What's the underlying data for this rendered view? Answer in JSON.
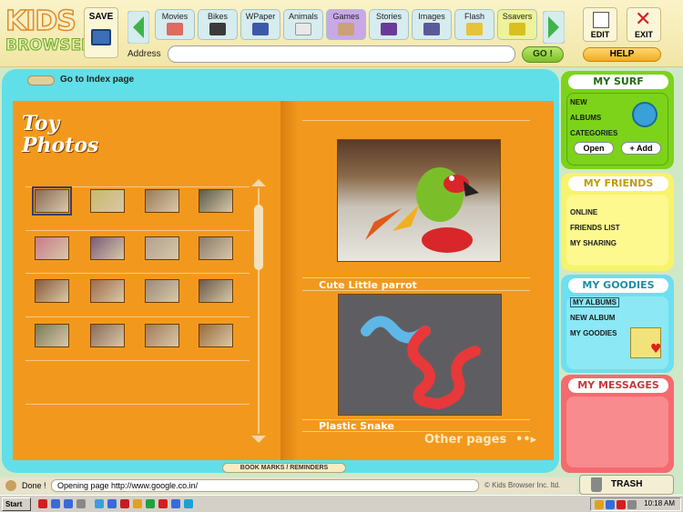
{
  "app": {
    "logo_line1": "KIDS",
    "logo_line2": "BROWSER"
  },
  "toolbar": {
    "save_label": "SAVE",
    "nav_buttons": [
      {
        "label": "Movies",
        "icon": "movies-icon",
        "color": "#e06a5f"
      },
      {
        "label": "Bikes",
        "icon": "bike-icon",
        "color": "#3a3a3a"
      },
      {
        "label": "WPaper",
        "icon": "wallpaper-icon",
        "color": "#3d5aa8"
      },
      {
        "label": "Animals",
        "icon": "animals-icon",
        "color": "#e8e8e8"
      },
      {
        "label": "Games",
        "icon": "games-icon",
        "color": "#c9a27a"
      },
      {
        "label": "Stories",
        "icon": "stories-icon",
        "color": "#6a3a9a"
      },
      {
        "label": "Images",
        "icon": "images-icon",
        "color": "#5a5a9a"
      },
      {
        "label": "Flash",
        "icon": "flash-icon",
        "color": "#e8c23a"
      },
      {
        "label": "Ssavers",
        "icon": "screensaver-icon",
        "color": "#d8c020"
      }
    ],
    "address_label": "Address",
    "address_value": "",
    "go_label": "GO !",
    "edit_label": "EDIT",
    "exit_label": "EXIT",
    "help_label": "HELP"
  },
  "main": {
    "index_link": "Go to Index page",
    "album_title_line1": "Toy",
    "album_title_line2": "Photos",
    "thumb_colors": [
      [
        "#8a6b5a",
        "#c9b86a",
        "#9a7a5a",
        "#5a5a4a"
      ],
      [
        "#c97a8a",
        "#7a5a7a",
        "#b0a090",
        "#8a7a6a"
      ],
      [
        "#8a5a3a",
        "#a06a4a",
        "#9a8a7a",
        "#6a5a4a"
      ],
      [
        "#7a7a5a",
        "#8a6a5a",
        "#a07a5a",
        "#9a6a3a"
      ]
    ],
    "photos": [
      {
        "caption": "Cute Little parrot"
      },
      {
        "caption": "Plastic Snake"
      }
    ],
    "other_pages": "Other pages",
    "bookmarks": "BOOK MARKS / REMINDERS"
  },
  "panels": {
    "mysurf": {
      "title": "MY SURF",
      "items": [
        "NEW",
        "ALBUMS",
        "CATEGORIES"
      ],
      "open": "Open",
      "add": "+ Add"
    },
    "myfriends": {
      "title": "MY FRIENDS",
      "items": [
        "ONLINE",
        "FRIENDS LIST",
        "MY SHARING"
      ]
    },
    "mygoodies": {
      "title": "MY GOODIES",
      "items": [
        "MY ALBUMS",
        "NEW ALBUM",
        "MY GOODIES"
      ]
    },
    "mymessages": {
      "title": "MY MESSAGES"
    }
  },
  "status": {
    "done": "Done !",
    "message": "Opening page http://www.google.co.in/",
    "copyright": "© Kids Browser Inc. ltd.",
    "trash": "TRASH"
  },
  "taskbar": {
    "start": "Start",
    "clock": "10:18 AM"
  },
  "colors": {
    "frame": "#61dfe8",
    "book": "#f2991d",
    "mysurf": "#7cd31a",
    "myfriends": "#f8f36c",
    "mygoodies": "#6cdff0",
    "mymessages": "#f56a6e"
  }
}
